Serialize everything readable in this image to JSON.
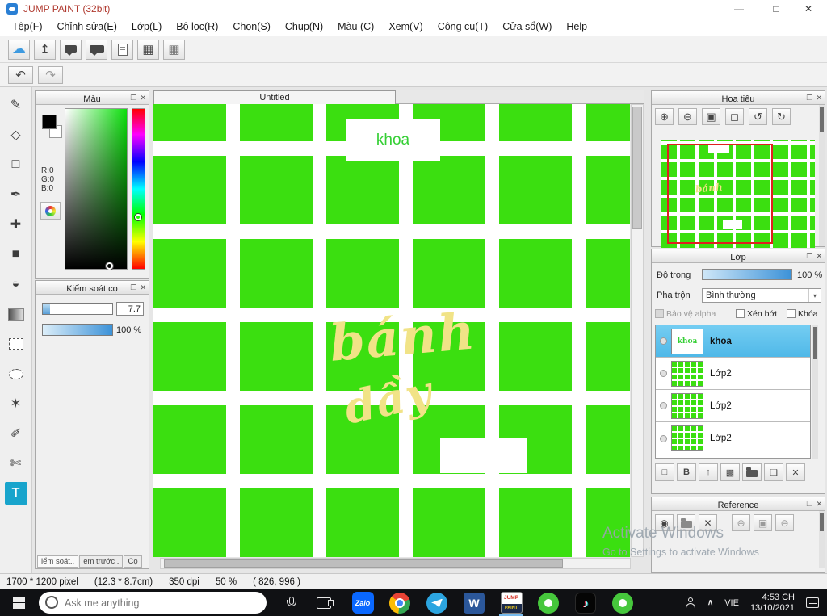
{
  "window": {
    "title": "JUMP PAINT (32bit)"
  },
  "menu": {
    "items": [
      "Tệp(F)",
      "Chỉnh sửa(E)",
      "Lớp(L)",
      "Bộ lọc(R)",
      "Chọn(S)",
      "Chụp(N)",
      "Màu (C)",
      "Xem(V)",
      "Công cụ(T)",
      "Cửa sổ(W)",
      "Help"
    ]
  },
  "color_panel": {
    "title": "Màu",
    "r": "R:0",
    "g": "G:0",
    "b": "B:0"
  },
  "brush_panel": {
    "title": "Kiểm soát cọ",
    "size_value": "7.7",
    "opacity_value": "100 %",
    "tabs": [
      "iểm soát..",
      "em trước .",
      "Cọ"
    ]
  },
  "canvas": {
    "tab": "Untitled",
    "khoa": "khoa",
    "banh": "bánh",
    "day": "dầy"
  },
  "navigator": {
    "title": "Hoa tiêu"
  },
  "layers": {
    "title": "Lớp",
    "opacity_label": "Độ trong",
    "opacity_value": "100 %",
    "blend_label": "Pha trộn",
    "blend_value": "Bình thường",
    "checkboxes": [
      "Bảo vệ alpha",
      "Xén bớt",
      "Khóa"
    ],
    "items": [
      {
        "label": "khoa",
        "thumb_text": "khoa",
        "selected": true
      },
      {
        "label": "Lớp2"
      },
      {
        "label": "Lớp2"
      },
      {
        "label": "Lớp2"
      }
    ]
  },
  "reference": {
    "title": "Reference"
  },
  "status": {
    "segments": [
      "1700 * 1200 pixel",
      "(12.3 * 8.7cm)",
      "350 dpi",
      "50 %",
      "( 826, 996 )"
    ]
  },
  "watermark": {
    "line1": "Activate Windows",
    "line2": "Go to Settings to activate Windows"
  },
  "taskbar": {
    "search_placeholder": "Ask me anything",
    "language": "VIE",
    "time": "4:53 CH",
    "date": "13/10/2021",
    "zalo_label": "Zalo",
    "word_label": "W",
    "jump_top": "JUMP",
    "jump_bottom": "PAINT",
    "tiktok_glyph": "♪"
  },
  "icons": {
    "minimize": "—",
    "maximize": "□",
    "close": "✕",
    "cloud": "☁",
    "upload": "↥",
    "grid_table": "▦",
    "undo": "↶",
    "redo": "↷",
    "popout": "❐",
    "panel_close": "✕",
    "pen": "✎",
    "eraser": "◇",
    "rect": "□",
    "ctrl_pen": "✒",
    "move": "✚",
    "fill_rect": "■",
    "bucket": "◒",
    "wand": "✶",
    "sel_pen": "✐",
    "sel_eraser": "✄",
    "text_tool": "T",
    "zoom_in": "⊕",
    "zoom_out": "⊖",
    "fit": "▣",
    "actual_size": "◻",
    "rotate_ccw": "↺",
    "rotate_cw": "↻",
    "dropdown": "▾",
    "pick": "◉",
    "layer_new": "□",
    "layer_b": "B",
    "layer_up": "↑",
    "layer_checker": "▩",
    "layer_dup": "❏",
    "layer_del": "✕",
    "chevron_up": "∧"
  },
  "colors": {
    "grid_green": "#3bdf10",
    "selection_blue": "#5ec2ec",
    "slider_blue": "#3c92d8",
    "script_yellow": "#f1e387",
    "tool_teal": "#18a4cc",
    "title_red": "#b03a30"
  }
}
